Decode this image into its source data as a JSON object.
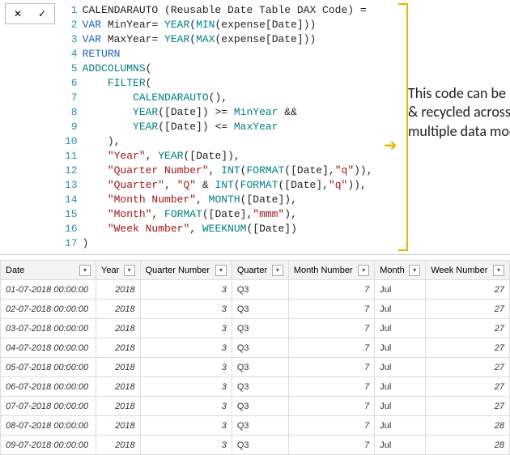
{
  "toolbar": {
    "cancel_icon": "✕",
    "commit_icon": "✓"
  },
  "code": {
    "lines": [
      [
        {
          "t": "CALENDARAUTO (Reusable Date Table DAX Code) ",
          "c": "id"
        },
        {
          "t": "=",
          "c": "op"
        }
      ],
      [
        {
          "t": "VAR ",
          "c": "kw"
        },
        {
          "t": "MinYear",
          "c": "id"
        },
        {
          "t": "= ",
          "c": "op"
        },
        {
          "t": "YEAR",
          "c": "fn"
        },
        {
          "t": "(",
          "c": "op"
        },
        {
          "t": "MIN",
          "c": "fn"
        },
        {
          "t": "(expense[Date]))",
          "c": "op"
        }
      ],
      [
        {
          "t": "VAR ",
          "c": "kw"
        },
        {
          "t": "MaxYear",
          "c": "id"
        },
        {
          "t": "= ",
          "c": "op"
        },
        {
          "t": "YEAR",
          "c": "fn"
        },
        {
          "t": "(",
          "c": "op"
        },
        {
          "t": "MAX",
          "c": "fn"
        },
        {
          "t": "(expense[Date]))",
          "c": "op"
        }
      ],
      [
        {
          "t": "RETURN",
          "c": "kw"
        }
      ],
      [
        {
          "t": "ADDCOLUMNS",
          "c": "fn"
        },
        {
          "t": "(",
          "c": "op"
        }
      ],
      [
        {
          "t": "    ",
          "c": "op"
        },
        {
          "t": "FILTER",
          "c": "fn"
        },
        {
          "t": "(",
          "c": "op"
        }
      ],
      [
        {
          "t": "        ",
          "c": "op"
        },
        {
          "t": "CALENDARAUTO",
          "c": "fn"
        },
        {
          "t": "(),",
          "c": "op"
        }
      ],
      [
        {
          "t": "        ",
          "c": "op"
        },
        {
          "t": "YEAR",
          "c": "fn"
        },
        {
          "t": "([Date]) >= ",
          "c": "op"
        },
        {
          "t": "MinYear",
          "c": "fn"
        },
        {
          "t": " &&",
          "c": "op"
        }
      ],
      [
        {
          "t": "        ",
          "c": "op"
        },
        {
          "t": "YEAR",
          "c": "fn"
        },
        {
          "t": "([Date]) <= ",
          "c": "op"
        },
        {
          "t": "MaxYear",
          "c": "fn"
        }
      ],
      [
        {
          "t": "    ),",
          "c": "op"
        }
      ],
      [
        {
          "t": "    ",
          "c": "op"
        },
        {
          "t": "\"Year\"",
          "c": "str"
        },
        {
          "t": ", ",
          "c": "op"
        },
        {
          "t": "YEAR",
          "c": "fn"
        },
        {
          "t": "([Date]),",
          "c": "op"
        }
      ],
      [
        {
          "t": "    ",
          "c": "op"
        },
        {
          "t": "\"Quarter Number\"",
          "c": "str"
        },
        {
          "t": ", ",
          "c": "op"
        },
        {
          "t": "INT",
          "c": "fn"
        },
        {
          "t": "(",
          "c": "op"
        },
        {
          "t": "FORMAT",
          "c": "fn"
        },
        {
          "t": "([Date],",
          "c": "op"
        },
        {
          "t": "\"q\"",
          "c": "str"
        },
        {
          "t": ")),",
          "c": "op"
        }
      ],
      [
        {
          "t": "    ",
          "c": "op"
        },
        {
          "t": "\"Quarter\"",
          "c": "str"
        },
        {
          "t": ", ",
          "c": "op"
        },
        {
          "t": "\"Q\"",
          "c": "str"
        },
        {
          "t": " & ",
          "c": "op"
        },
        {
          "t": "INT",
          "c": "fn"
        },
        {
          "t": "(",
          "c": "op"
        },
        {
          "t": "FORMAT",
          "c": "fn"
        },
        {
          "t": "([Date],",
          "c": "op"
        },
        {
          "t": "\"q\"",
          "c": "str"
        },
        {
          "t": ")),",
          "c": "op"
        }
      ],
      [
        {
          "t": "    ",
          "c": "op"
        },
        {
          "t": "\"Month Number\"",
          "c": "str"
        },
        {
          "t": ", ",
          "c": "op"
        },
        {
          "t": "MONTH",
          "c": "fn"
        },
        {
          "t": "([Date]),",
          "c": "op"
        }
      ],
      [
        {
          "t": "    ",
          "c": "op"
        },
        {
          "t": "\"Month\"",
          "c": "str"
        },
        {
          "t": ", ",
          "c": "op"
        },
        {
          "t": "FORMAT",
          "c": "fn"
        },
        {
          "t": "([Date],",
          "c": "op"
        },
        {
          "t": "\"mmm\"",
          "c": "str"
        },
        {
          "t": "),",
          "c": "op"
        }
      ],
      [
        {
          "t": "    ",
          "c": "op"
        },
        {
          "t": "\"Week Number\"",
          "c": "str"
        },
        {
          "t": ", ",
          "c": "op"
        },
        {
          "t": "WEEKNUM",
          "c": "fn"
        },
        {
          "t": "([Date])",
          "c": "op"
        }
      ],
      [
        {
          "t": ")",
          "c": "op"
        }
      ]
    ]
  },
  "annotation": {
    "text": "This code can be reused & recycled across multiple data models"
  },
  "table": {
    "columns": [
      "Date",
      "Year",
      "Quarter Number",
      "Quarter",
      "Month Number",
      "Month",
      "Week Number"
    ],
    "rows": [
      {
        "date": "01-07-2018 00:00:00",
        "year": "2018",
        "qn": "3",
        "q": "Q3",
        "mn": "7",
        "m": "Jul",
        "wn": "27"
      },
      {
        "date": "02-07-2018 00:00:00",
        "year": "2018",
        "qn": "3",
        "q": "Q3",
        "mn": "7",
        "m": "Jul",
        "wn": "27"
      },
      {
        "date": "03-07-2018 00:00:00",
        "year": "2018",
        "qn": "3",
        "q": "Q3",
        "mn": "7",
        "m": "Jul",
        "wn": "27"
      },
      {
        "date": "04-07-2018 00:00:00",
        "year": "2018",
        "qn": "3",
        "q": "Q3",
        "mn": "7",
        "m": "Jul",
        "wn": "27"
      },
      {
        "date": "05-07-2018 00:00:00",
        "year": "2018",
        "qn": "3",
        "q": "Q3",
        "mn": "7",
        "m": "Jul",
        "wn": "27"
      },
      {
        "date": "06-07-2018 00:00:00",
        "year": "2018",
        "qn": "3",
        "q": "Q3",
        "mn": "7",
        "m": "Jul",
        "wn": "27"
      },
      {
        "date": "07-07-2018 00:00:00",
        "year": "2018",
        "qn": "3",
        "q": "Q3",
        "mn": "7",
        "m": "Jul",
        "wn": "27"
      },
      {
        "date": "08-07-2018 00:00:00",
        "year": "2018",
        "qn": "3",
        "q": "Q3",
        "mn": "7",
        "m": "Jul",
        "wn": "28"
      },
      {
        "date": "09-07-2018 00:00:00",
        "year": "2018",
        "qn": "3",
        "q": "Q3",
        "mn": "7",
        "m": "Jul",
        "wn": "28"
      }
    ]
  },
  "dropdown_glyph": "▾"
}
